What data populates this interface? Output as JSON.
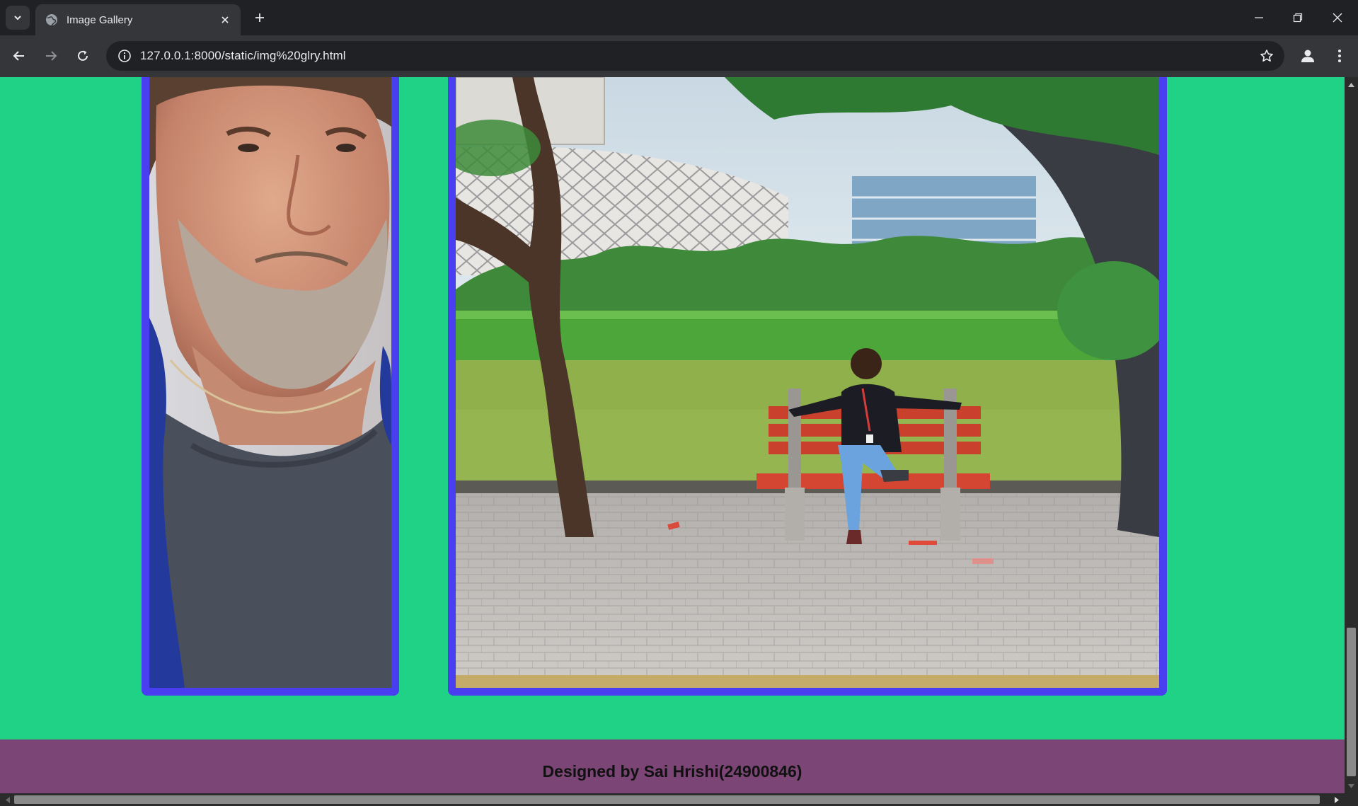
{
  "browser": {
    "tab": {
      "title": "Image Gallery"
    },
    "address_bar": {
      "url": "127.0.0.1:8000/static/img%20glry.html"
    }
  },
  "icons": {
    "tab_search": "chevron-down-icon",
    "favicon": "globe-icon",
    "tab_close": "close-icon",
    "new_tab": "plus-icon",
    "minimize": "minimize-icon",
    "restore": "restore-icon",
    "window_close": "close-icon",
    "back": "arrow-left-icon",
    "forward": "arrow-right-icon",
    "reload": "reload-icon",
    "site_info": "info-icon",
    "bookmark": "star-icon",
    "profile": "person-icon",
    "menu": "kebab-menu-icon"
  },
  "gallery": {
    "images": [
      {
        "subject": "portrait-photo"
      },
      {
        "subject": "park-bench-photo"
      }
    ]
  },
  "footer": {
    "text": "Designed by Sai Hrishi(24900846)"
  },
  "colors": {
    "page_background": "#1fd286",
    "image_frame": "#4a3ff0",
    "footer_background": "#7b4676"
  }
}
